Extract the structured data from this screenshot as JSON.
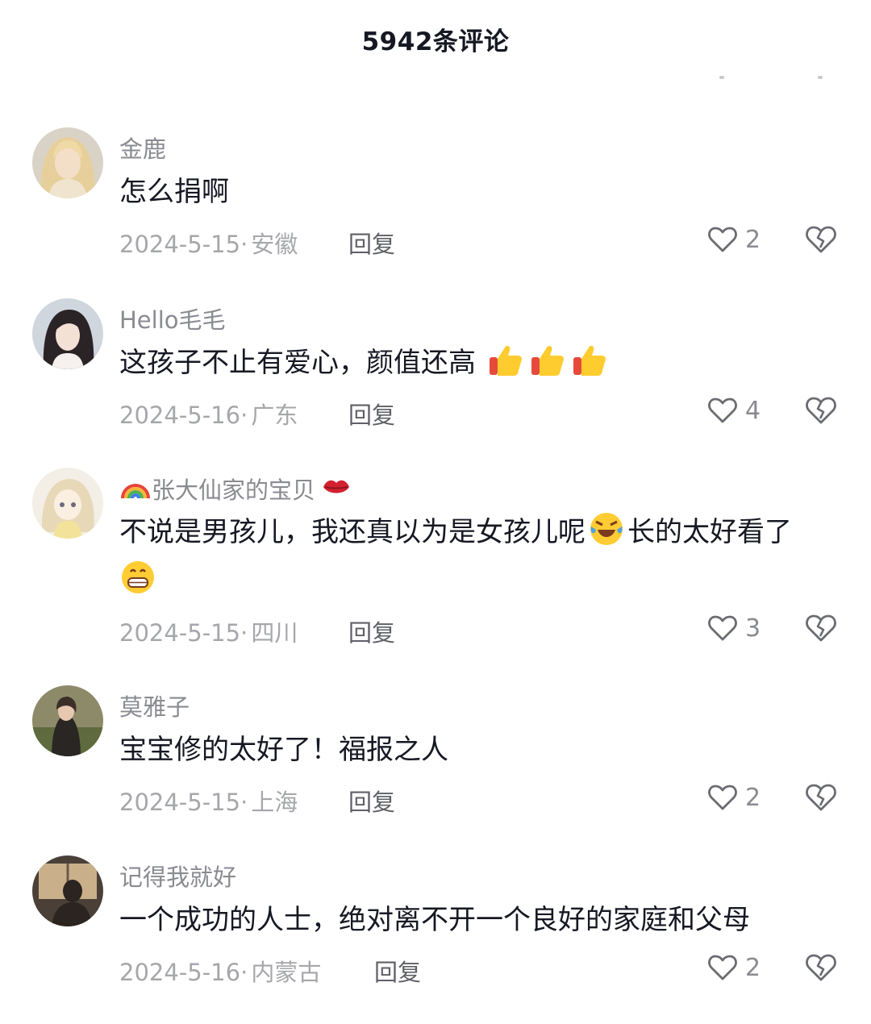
{
  "header": {
    "title": "5942条评论"
  },
  "comments": [
    {
      "username": "金鹿",
      "text": "怎么捐啊",
      "date": "2024-5-15·",
      "location": "安徽",
      "reply_label": "回复",
      "likes": "2",
      "avatar_icon": "avatar-blonde-girl-icon"
    },
    {
      "username": "Hello毛毛",
      "text": "这孩子不止有爱心，颜值还高",
      "emojis": [
        "thumbs-up-icon",
        "thumbs-up-icon",
        "thumbs-up-icon"
      ],
      "date": "2024-5-16·",
      "location": "广东",
      "reply_label": "回复",
      "likes": "4",
      "avatar_icon": "avatar-dark-hair-girl-icon"
    },
    {
      "username": "张大仙家的宝贝",
      "username_emojis": [
        "rainbow-icon",
        "kiss-mark-icon"
      ],
      "text_part1": "不说是男孩儿，我还真以为是女孩儿呢",
      "text_part2": "长的太好看了",
      "emojis": [
        "laughing-crying-icon",
        "grinning-face-icon"
      ],
      "date": "2024-5-15·",
      "location": "四川",
      "reply_label": "回复",
      "likes": "3",
      "avatar_icon": "avatar-anime-girl-icon"
    },
    {
      "username": "莫雅子",
      "text": "宝宝修的太好了！福报之人",
      "date": "2024-5-15·",
      "location": "上海",
      "reply_label": "回复",
      "likes": "2",
      "avatar_icon": "avatar-outdoor-photo-icon"
    },
    {
      "username": "记得我就好",
      "text": "一个成功的人士，绝对离不开一个良好的家庭和父母",
      "date": "2024-5-16·",
      "location": "内蒙古",
      "reply_label": "回复",
      "likes": "2",
      "avatar_icon": "avatar-silhouette-window-icon"
    }
  ],
  "colors": {
    "text_primary": "#161823",
    "text_secondary": "#8a8b91",
    "text_meta": "#a6a7ab",
    "icon_stroke": "#6b6c72"
  }
}
